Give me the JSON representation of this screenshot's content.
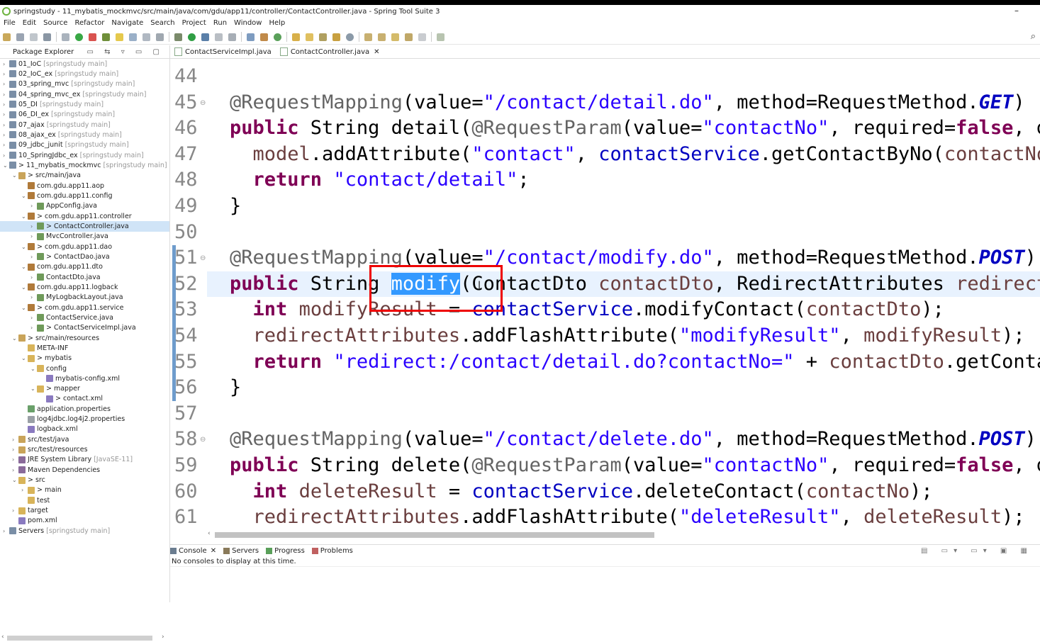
{
  "window": {
    "title": "springstudy - 11_mybatis_mockmvc/src/main/java/com/gdu/app11/controller/ContactController.java - Spring Tool Suite 3",
    "minimize": "–"
  },
  "menu": [
    "File",
    "Edit",
    "Source",
    "Refactor",
    "Navigate",
    "Search",
    "Project",
    "Run",
    "Window",
    "Help"
  ],
  "package_explorer": {
    "title": "Package Explorer",
    "tree": [
      {
        "label": "01_IoC",
        "decor": "[springstudy main]",
        "indent": 0,
        "arrow": ">",
        "icon": "project"
      },
      {
        "label": "02_IoC_ex",
        "decor": "[springstudy main]",
        "indent": 0,
        "arrow": ">",
        "icon": "project"
      },
      {
        "label": "03_spring_mvc",
        "decor": "[springstudy main]",
        "indent": 0,
        "arrow": ">",
        "icon": "project"
      },
      {
        "label": "04_spring_mvc_ex",
        "decor": "[springstudy main]",
        "indent": 0,
        "arrow": ">",
        "icon": "project"
      },
      {
        "label": "05_DI",
        "decor": "[springstudy main]",
        "indent": 0,
        "arrow": ">",
        "icon": "project"
      },
      {
        "label": "06_DI_ex",
        "decor": "[springstudy main]",
        "indent": 0,
        "arrow": ">",
        "icon": "project"
      },
      {
        "label": "07_ajax",
        "decor": "[springstudy main]",
        "indent": 0,
        "arrow": ">",
        "icon": "project"
      },
      {
        "label": "08_ajax_ex",
        "decor": "[springstudy main]",
        "indent": 0,
        "arrow": ">",
        "icon": "project"
      },
      {
        "label": "09_jdbc_junit",
        "decor": "[springstudy main]",
        "indent": 0,
        "arrow": ">",
        "icon": "project"
      },
      {
        "label": "10_SpringJdbc_ex",
        "decor": "[springstudy main]",
        "indent": 0,
        "arrow": ">",
        "icon": "project"
      },
      {
        "label": "> 11_mybatis_mockmvc",
        "decor": "[springstudy main]",
        "indent": 0,
        "arrow": "v",
        "icon": "project"
      },
      {
        "label": "> src/main/java",
        "decor": "",
        "indent": 1,
        "arrow": "v",
        "icon": "srcfolder"
      },
      {
        "label": "com.gdu.app11.aop",
        "decor": "",
        "indent": 2,
        "arrow": "",
        "icon": "package"
      },
      {
        "label": "com.gdu.app11.config",
        "decor": "",
        "indent": 2,
        "arrow": "v",
        "icon": "package"
      },
      {
        "label": "AppConfig.java",
        "decor": "",
        "indent": 3,
        "arrow": ">",
        "icon": "java"
      },
      {
        "label": "> com.gdu.app11.controller",
        "decor": "",
        "indent": 2,
        "arrow": "v",
        "icon": "package"
      },
      {
        "label": "> ContactController.java",
        "decor": "",
        "indent": 3,
        "arrow": ">",
        "icon": "java",
        "selected": true
      },
      {
        "label": "MvcController.java",
        "decor": "",
        "indent": 3,
        "arrow": ">",
        "icon": "java"
      },
      {
        "label": "> com.gdu.app11.dao",
        "decor": "",
        "indent": 2,
        "arrow": "v",
        "icon": "package"
      },
      {
        "label": "> ContactDao.java",
        "decor": "",
        "indent": 3,
        "arrow": ">",
        "icon": "java"
      },
      {
        "label": "com.gdu.app11.dto",
        "decor": "",
        "indent": 2,
        "arrow": "v",
        "icon": "package"
      },
      {
        "label": "ContactDto.java",
        "decor": "",
        "indent": 3,
        "arrow": ">",
        "icon": "java"
      },
      {
        "label": "com.gdu.app11.logback",
        "decor": "",
        "indent": 2,
        "arrow": "v",
        "icon": "package"
      },
      {
        "label": "MyLogbackLayout.java",
        "decor": "",
        "indent": 3,
        "arrow": ">",
        "icon": "java"
      },
      {
        "label": "> com.gdu.app11.service",
        "decor": "",
        "indent": 2,
        "arrow": "v",
        "icon": "package"
      },
      {
        "label": "ContactService.java",
        "decor": "",
        "indent": 3,
        "arrow": ">",
        "icon": "java"
      },
      {
        "label": "> ContactServiceImpl.java",
        "decor": "",
        "indent": 3,
        "arrow": ">",
        "icon": "java"
      },
      {
        "label": "> src/main/resources",
        "decor": "",
        "indent": 1,
        "arrow": "v",
        "icon": "srcfolder"
      },
      {
        "label": "META-INF",
        "decor": "",
        "indent": 2,
        "arrow": "",
        "icon": "folder"
      },
      {
        "label": "> mybatis",
        "decor": "",
        "indent": 2,
        "arrow": "v",
        "icon": "folder"
      },
      {
        "label": "config",
        "decor": "",
        "indent": 3,
        "arrow": "v",
        "icon": "folder"
      },
      {
        "label": "mybatis-config.xml",
        "decor": "",
        "indent": 4,
        "arrow": "",
        "icon": "xml"
      },
      {
        "label": "> mapper",
        "decor": "",
        "indent": 3,
        "arrow": "v",
        "icon": "folder"
      },
      {
        "label": "> contact.xml",
        "decor": "",
        "indent": 4,
        "arrow": "",
        "icon": "xml"
      },
      {
        "label": "application.properties",
        "decor": "",
        "indent": 2,
        "arrow": "",
        "icon": "props"
      },
      {
        "label": "log4jdbc.log4j2.properties",
        "decor": "",
        "indent": 2,
        "arrow": "",
        "icon": "file"
      },
      {
        "label": "logback.xml",
        "decor": "",
        "indent": 2,
        "arrow": "",
        "icon": "xml"
      },
      {
        "label": "src/test/java",
        "decor": "",
        "indent": 1,
        "arrow": ">",
        "icon": "srcfolder"
      },
      {
        "label": "src/test/resources",
        "decor": "",
        "indent": 1,
        "arrow": ">",
        "icon": "srcfolder"
      },
      {
        "label": "JRE System Library",
        "decor": "[JavaSE-11]",
        "indent": 1,
        "arrow": ">",
        "icon": "lib"
      },
      {
        "label": "Maven Dependencies",
        "decor": "",
        "indent": 1,
        "arrow": ">",
        "icon": "lib"
      },
      {
        "label": "> src",
        "decor": "",
        "indent": 1,
        "arrow": "v",
        "icon": "folder"
      },
      {
        "label": "> main",
        "decor": "",
        "indent": 2,
        "arrow": ">",
        "icon": "folder"
      },
      {
        "label": "test",
        "decor": "",
        "indent": 2,
        "arrow": "",
        "icon": "folder"
      },
      {
        "label": "target",
        "decor": "",
        "indent": 1,
        "arrow": ">",
        "icon": "folder"
      },
      {
        "label": "pom.xml",
        "decor": "",
        "indent": 1,
        "arrow": "",
        "icon": "xml"
      },
      {
        "label": "Servers",
        "decor": "[springstudy main]",
        "indent": 0,
        "arrow": ">",
        "icon": "project"
      }
    ]
  },
  "editor_tabs": [
    {
      "label": "ContactServiceImpl.java",
      "active": false
    },
    {
      "label": "ContactController.java",
      "active": true
    }
  ],
  "editor": {
    "line_numbers": [
      "44",
      "45",
      "46",
      "47",
      "48",
      "49",
      "50",
      "51",
      "52",
      "53",
      "54",
      "55",
      "56",
      "57",
      "58",
      "59",
      "60",
      "61"
    ],
    "selected_word": "modify"
  },
  "console": {
    "tabs": [
      "Console",
      "Servers",
      "Progress",
      "Problems"
    ],
    "message": "No consoles to display at this time."
  },
  "colors": {
    "keyword": "#7f0055",
    "string": "#2a00ff",
    "field": "#0000c0",
    "annotation": "#646464",
    "selection": "#3399ff",
    "highlight_box": "#e00000"
  }
}
